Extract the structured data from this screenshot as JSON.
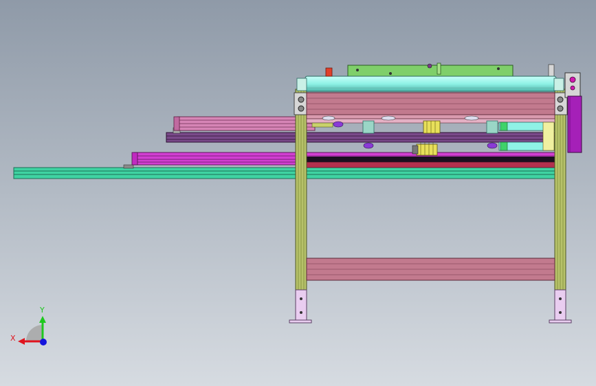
{
  "viewport": {
    "background_top": "#8f9aa8",
    "background_bottom": "#d6dbe1"
  },
  "triad": {
    "x_label": "X",
    "y_label": "Y",
    "x_color": "#e0141e",
    "y_color": "#1ec81e",
    "z_color": "#1414dc"
  },
  "colors": {
    "frame_post": "#b7c26a",
    "frame_post_dark": "#7d8a3a",
    "beam_pink": "#c27a8e",
    "beam_pink_dark": "#8d4e60",
    "rail_teal": "#3fd3a2",
    "rail_magenta": "#d23fd2",
    "rail_violet": "#7a4a8a",
    "roller_cyan": "#8ff2e6",
    "plate_green": "#7fcf6a",
    "foot_lilac": "#e9cdf0",
    "bracket_purple": "#a520b8",
    "accent_yellow": "#e8e05a",
    "accent_red": "#e0402a"
  }
}
